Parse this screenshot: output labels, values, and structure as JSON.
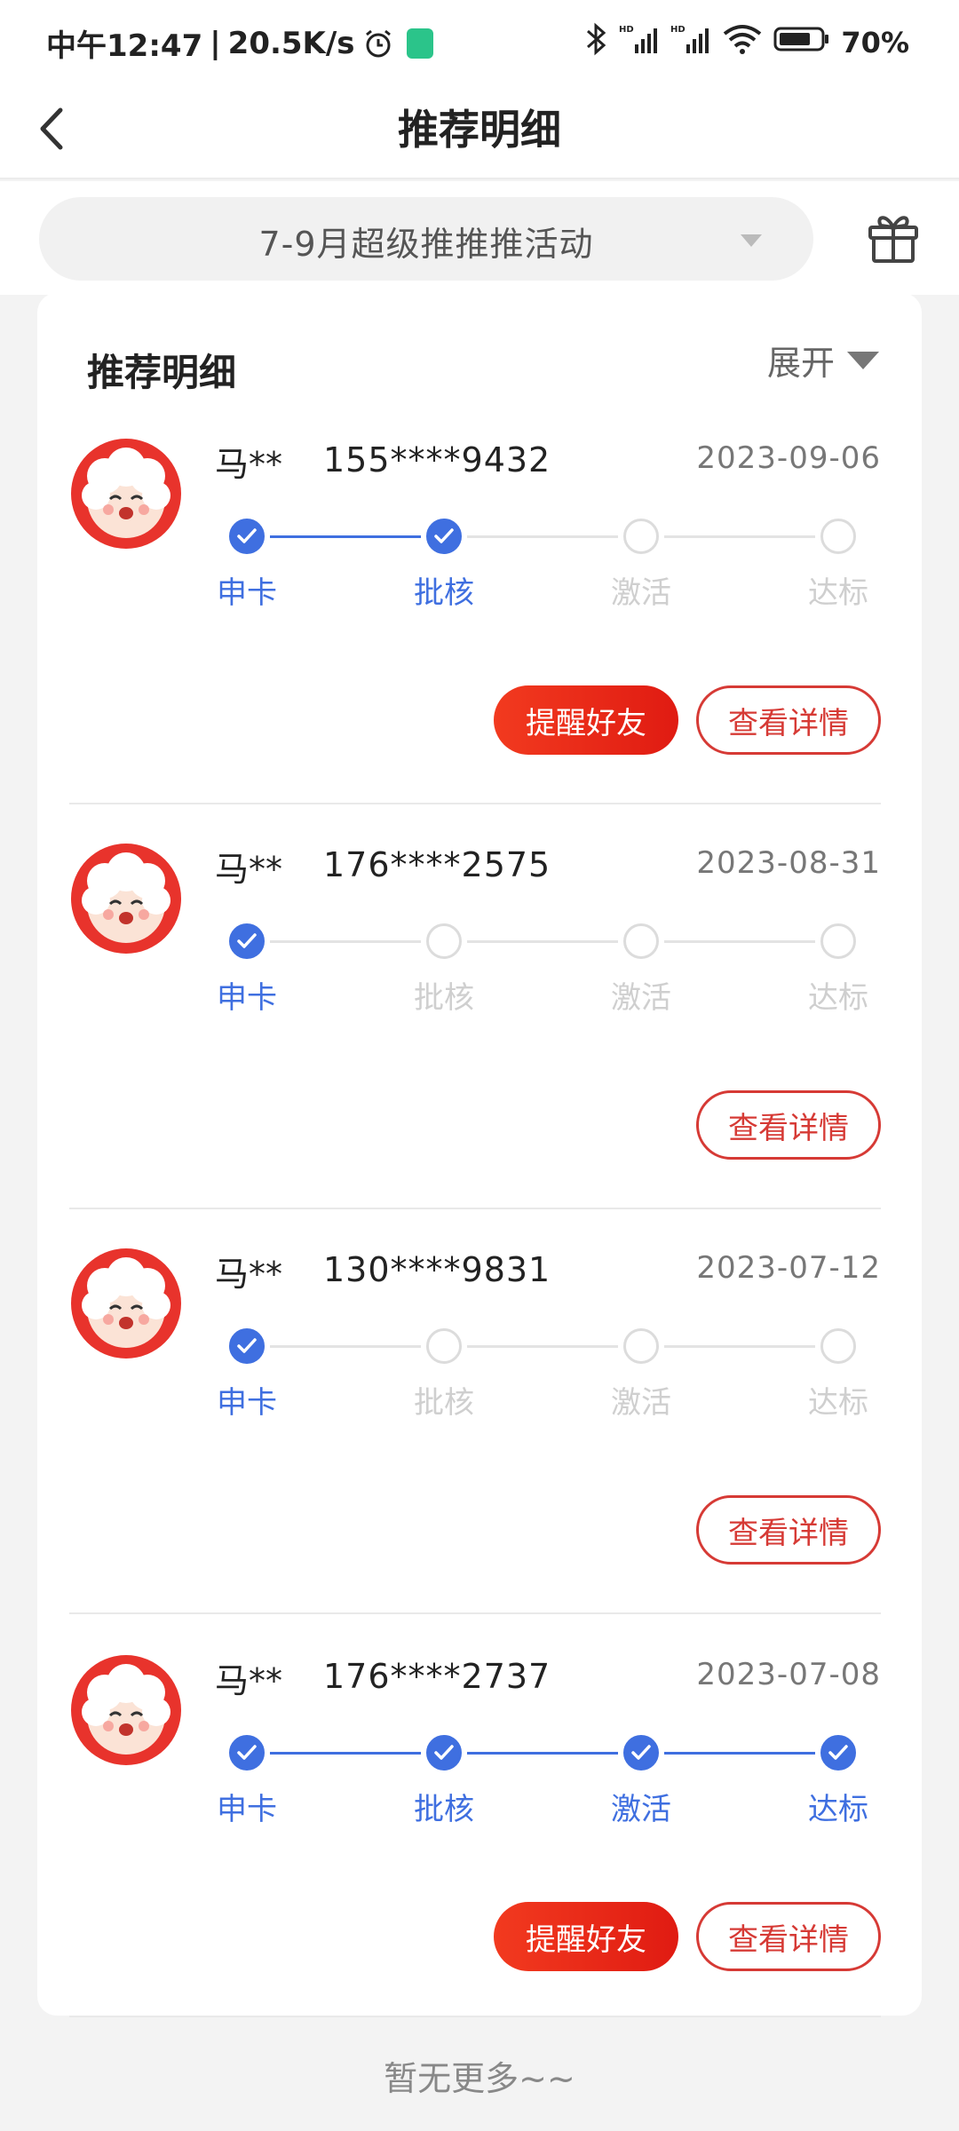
{
  "status_bar": {
    "time": "中午12:47",
    "net_speed": "20.5K/s",
    "network": "HD",
    "battery": "70%"
  },
  "header": {
    "title": "推荐明细"
  },
  "filter": {
    "selected": "7-9月超级推推推活动"
  },
  "card": {
    "title": "推荐明细",
    "expand_label": "展开"
  },
  "step_labels": [
    "申卡",
    "批核",
    "激活",
    "达标"
  ],
  "records": [
    {
      "name": "马**",
      "phone": "155****9432",
      "date": "2023-09-06",
      "completed_steps": 2,
      "show_remind": true
    },
    {
      "name": "马**",
      "phone": "176****2575",
      "date": "2023-08-31",
      "completed_steps": 1,
      "show_remind": false
    },
    {
      "name": "马**",
      "phone": "130****9831",
      "date": "2023-07-12",
      "completed_steps": 1,
      "show_remind": false
    },
    {
      "name": "马**",
      "phone": "176****2737",
      "date": "2023-07-08",
      "completed_steps": 4,
      "show_remind": true
    }
  ],
  "buttons": {
    "remind_label": "提醒好友",
    "detail_label": "查看详情"
  },
  "footer": {
    "text": "暂无更多~~"
  },
  "colors": {
    "accent_blue": "#3f6fe0",
    "accent_red": "#e01b12",
    "inactive": "#dcdcdc"
  }
}
